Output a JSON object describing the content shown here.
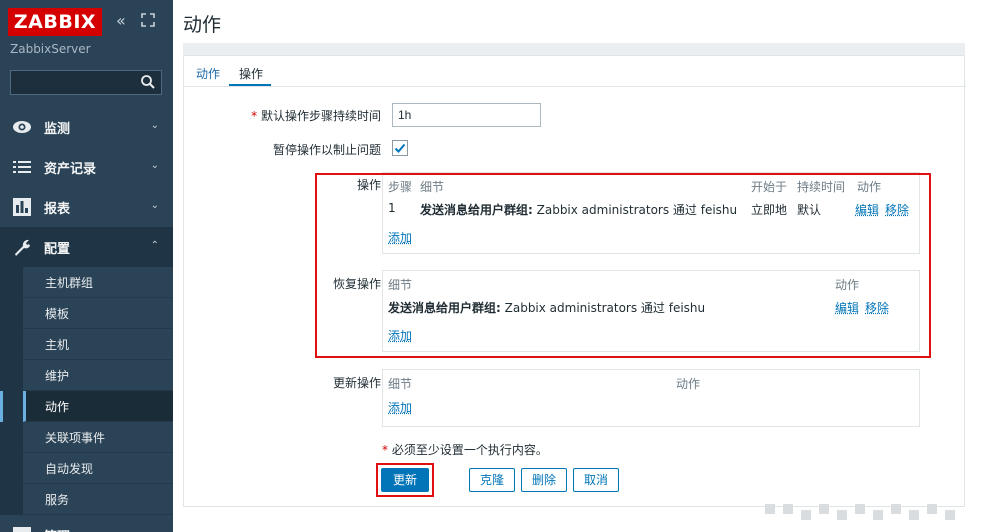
{
  "brand": {
    "logo": "ZABBIX",
    "server": "ZabbixServer"
  },
  "sidebar": {
    "search_placeholder": "",
    "menu": [
      {
        "label": "监测",
        "icon": "eye-icon"
      },
      {
        "label": "资产记录",
        "icon": "list-icon"
      },
      {
        "label": "报表",
        "icon": "bar-chart-icon"
      },
      {
        "label": "配置",
        "icon": "wrench-icon"
      }
    ],
    "submenu": [
      "主机群组",
      "模板",
      "主机",
      "维护",
      "动作",
      "关联项事件",
      "自动发现",
      "服务"
    ],
    "next_menu": "管理"
  },
  "page": {
    "title": "动作"
  },
  "tabs": [
    "动作",
    "操作"
  ],
  "form": {
    "step_duration_label": "默认操作步骤持续时间",
    "step_duration_value": "1h",
    "pause_label": "暂停操作以制止问题",
    "operations_label": "操作",
    "recovery_label": "恢复操作",
    "update_label": "更新操作"
  },
  "operations": {
    "headers": [
      "步骤",
      "细节",
      "开始于",
      "持续时间",
      "动作"
    ],
    "row": {
      "step": "1",
      "detail_bold": "发送消息给用户群组:",
      "detail_rest": " Zabbix administrators 通过 feishu",
      "start": "立即地",
      "duration": "默认",
      "edit": "编辑",
      "remove": "移除"
    },
    "add": "添加"
  },
  "recovery": {
    "headers": [
      "细节",
      "动作"
    ],
    "row": {
      "detail_bold": "发送消息给用户群组:",
      "detail_rest": " Zabbix administrators 通过 feishu",
      "edit": "编辑",
      "remove": "移除"
    },
    "add": "添加"
  },
  "update_ops": {
    "headers": [
      "细节",
      "动作"
    ],
    "add": "添加"
  },
  "note": "必须至少设置一个执行内容。",
  "buttons": {
    "update": "更新",
    "clone": "克隆",
    "delete": "删除",
    "cancel": "取消"
  },
  "colors": {
    "sidebar": "#2b4356",
    "accent": "#0275b8",
    "highlight": "#e01010",
    "logo": "#d40000"
  }
}
